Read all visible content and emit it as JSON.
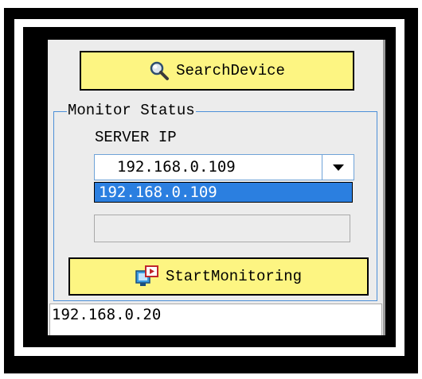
{
  "search_button": {
    "label": "SearchDevice",
    "icon": "magnifier-icon"
  },
  "monitor_status": {
    "title": "Monitor Status",
    "server_ip_label": "SERVER IP",
    "server_ip_selected": "192.168.0.109",
    "dropdown_options": [
      "192.168.0.109"
    ],
    "text_field_value": ""
  },
  "start_button": {
    "label": "StartMonitoring",
    "icon": "monitor-play-icon"
  },
  "device_list": {
    "items": [
      "192.168.0.20"
    ]
  },
  "colors": {
    "button_fill": "#fdf582",
    "group_border": "#4d90d8",
    "selection": "#2b7fe0",
    "panel_bg": "#ececec"
  }
}
